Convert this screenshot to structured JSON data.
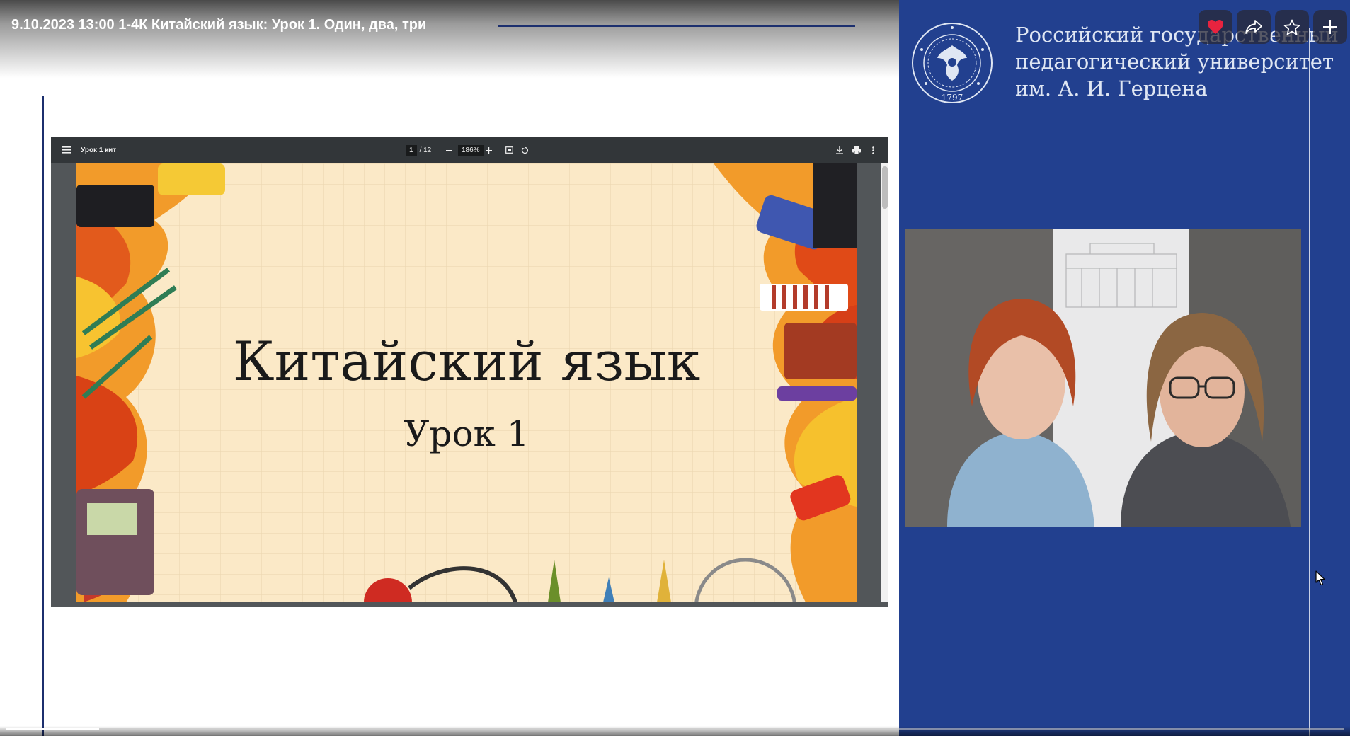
{
  "video": {
    "title": "9.10.2023 13:00 1-4К Китайский язык: Урок 1. Один, два, три",
    "progress_fraction": 0.07
  },
  "actions": {
    "like_icon": "heart-icon",
    "share_icon": "share-icon",
    "favorite_icon": "star-icon",
    "add_icon": "plus-icon",
    "like_color": "#e8233f"
  },
  "university": {
    "name_lines": [
      "Российский государственный",
      "педагогический университет",
      "им. А. И. Герцена"
    ],
    "seal_year": "1797"
  },
  "pdf_viewer": {
    "file_name": "Урок 1 кит",
    "current_page": "1",
    "total_pages": "/ 12",
    "zoom": "186%",
    "menu_icon": "menu-icon",
    "download_icon": "download-icon",
    "print_icon": "print-icon",
    "more_icon": "more-vert-icon"
  },
  "slide": {
    "title": "Китайский язык",
    "subtitle": "Урок 1"
  },
  "colors": {
    "panel_blue": "#22408f",
    "accent_line": "#1c2f6e",
    "viewer_toolbar": "#323639",
    "slide_bg": "#fbe9c7"
  }
}
